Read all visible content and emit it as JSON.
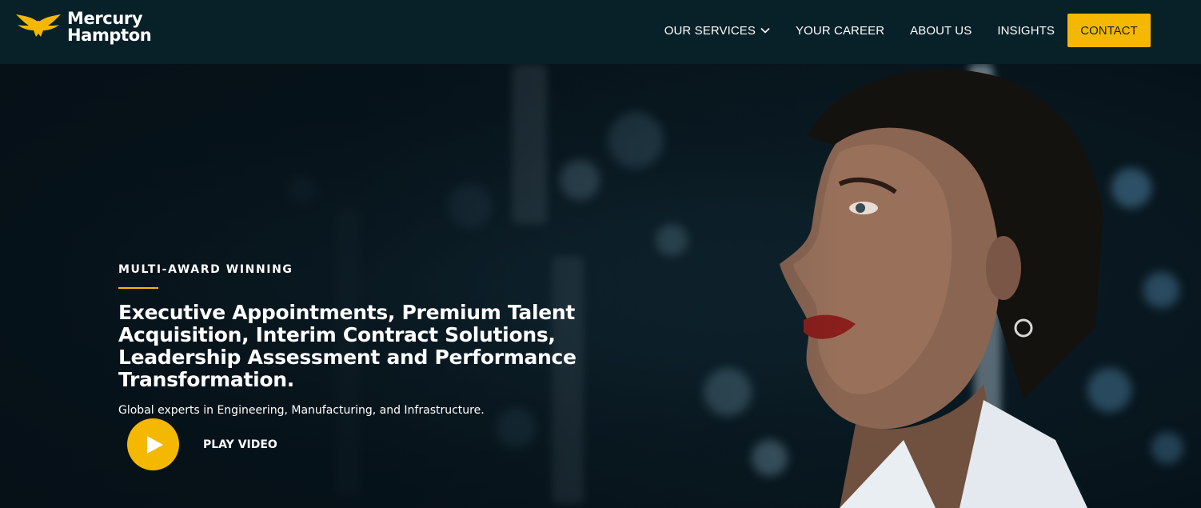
{
  "brand": {
    "name_line1": "Mercury",
    "name_line2": "Hampton",
    "logo_icon": "eagle-icon",
    "logo_color": "#f5b800"
  },
  "nav": {
    "items": [
      {
        "label": "OUR SERVICES",
        "has_dropdown": true
      },
      {
        "label": "YOUR CAREER",
        "has_dropdown": false
      },
      {
        "label": "ABOUT US",
        "has_dropdown": false
      },
      {
        "label": "INSIGHTS",
        "has_dropdown": false
      }
    ],
    "contact_label": "CONTACT"
  },
  "hero": {
    "eyebrow": "MULTI-AWARD WINNING",
    "headline": "Executive Appointments, Premium Talent Acquisition, Interim Contract Solutions, Leadership Assessment and Performance Transformation.",
    "subline": "Global experts in Engineering, Manufacturing, and Infrastructure.",
    "play_label": "PLAY VIDEO",
    "play_icon": "play-icon"
  },
  "colors": {
    "accent": "#f5b800",
    "header_bg": "#082028",
    "text": "#ffffff"
  }
}
